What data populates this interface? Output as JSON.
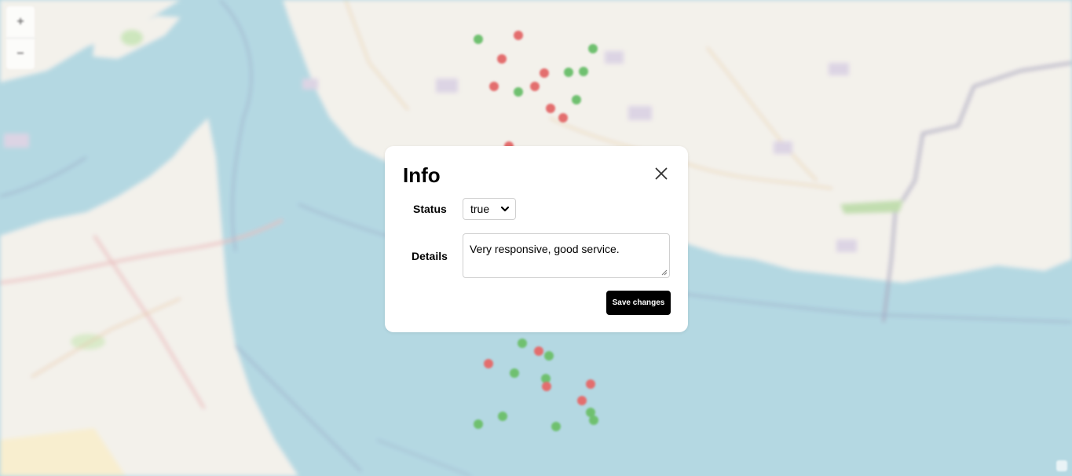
{
  "map": {
    "zoom_in_label": "+",
    "zoom_out_label": "−",
    "marker_colors": {
      "positive": "#5cb85c",
      "negative": "#e05a5a"
    },
    "water_color": "#aad3df",
    "land_color": "#f2efe9"
  },
  "modal": {
    "title": "Info",
    "status": {
      "label": "Status",
      "selected": "true"
    },
    "details": {
      "label": "Details",
      "value": "Very responsive, good service."
    },
    "save_label": "Save changes"
  }
}
